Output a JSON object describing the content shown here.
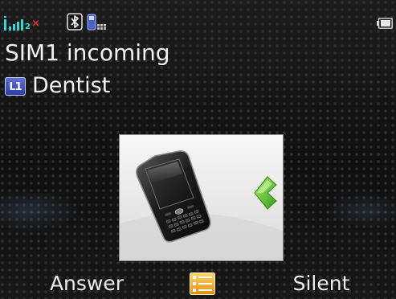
{
  "status_bar": {
    "signal_icon": "signal-strength-icon",
    "signal_sim_number": "2",
    "signal_no_service_icon": "no-service-x-icon",
    "bluetooth_icon": "bluetooth-icon",
    "phone_status_icon": "phone-keypad-icon",
    "battery_icon": "battery-icon",
    "accent_color": "#35d6d6",
    "alert_color": "#e03030"
  },
  "call": {
    "status_text": "SIM1 incoming",
    "line_badge": "L1",
    "contact_name": "Dentist",
    "caller_picture_icon": "smartphone-icon",
    "arrow_icon": "green-arrow-left-icon",
    "arrow_color": "#56c22c"
  },
  "softkeys": {
    "left_label": "Answer",
    "center_icon": "menu-list-icon",
    "right_label": "Silent"
  }
}
